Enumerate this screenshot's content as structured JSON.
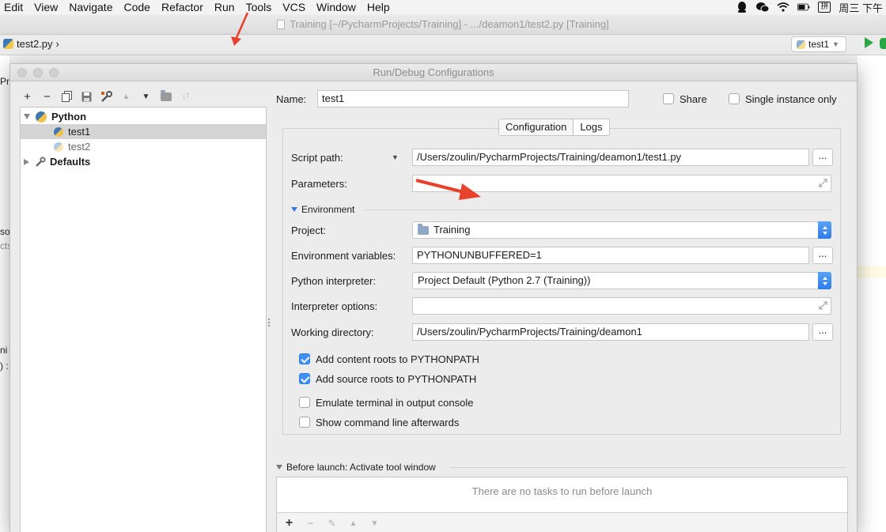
{
  "menubar": {
    "items": [
      "Edit",
      "View",
      "Navigate",
      "Code",
      "Refactor",
      "Run",
      "Tools",
      "VCS",
      "Window",
      "Help"
    ],
    "clock_text": "周三 下午",
    "ime_label": "拼"
  },
  "ide": {
    "window_title": "Training [~/PycharmProjects/Training] - .../deamon1/test2.py [Training]",
    "breadcrumb_file": "test2.py",
    "run_config": "test1",
    "left_gutter": [
      "Pro",
      "so",
      "cts",
      "ni",
      ") :"
    ]
  },
  "dialog": {
    "title": "Run/Debug Configurations",
    "tree": {
      "group_python": "Python",
      "item_test1": "test1",
      "item_test2": "test2",
      "group_defaults": "Defaults"
    },
    "name_label": "Name:",
    "name_value": "test1",
    "share_label": "Share",
    "single_instance_label": "Single instance only",
    "tabs": [
      "Configuration",
      "Logs"
    ],
    "form": {
      "script_path_label": "Script path:",
      "script_path_value": "/Users/zoulin/PycharmProjects/Training/deamon1/test1.py",
      "parameters_label": "Parameters:",
      "parameters_value": "",
      "environment_section": "Environment",
      "project_label": "Project:",
      "project_value": "Training",
      "env_vars_label": "Environment variables:",
      "env_vars_value": "PYTHONUNBUFFERED=1",
      "interpreter_label": "Python interpreter:",
      "interpreter_value": "Project Default (Python 2.7 (Training))",
      "interp_options_label": "Interpreter options:",
      "interp_options_value": "",
      "workdir_label": "Working directory:",
      "workdir_value": "/Users/zoulin/PycharmProjects/Training/deamon1",
      "add_content_roots": "Add content roots to PYTHONPATH",
      "add_source_roots": "Add source roots to PYTHONPATH",
      "emulate_terminal": "Emulate terminal in output console",
      "show_cmdline": "Show command line afterwards",
      "ellipsis": "..."
    },
    "checkbox_states": {
      "share": false,
      "single_instance": false,
      "add_content_roots": true,
      "add_source_roots": true,
      "emulate_terminal": false,
      "show_cmdline": false
    },
    "before_launch": {
      "title": "Before launch: Activate tool window",
      "empty_text": "There are no tasks to run before launch"
    }
  },
  "colors": {
    "annotation_arrow": "#e8412c",
    "checkbox_accent": "#3f8ff5",
    "run_green": "#2aa845"
  }
}
